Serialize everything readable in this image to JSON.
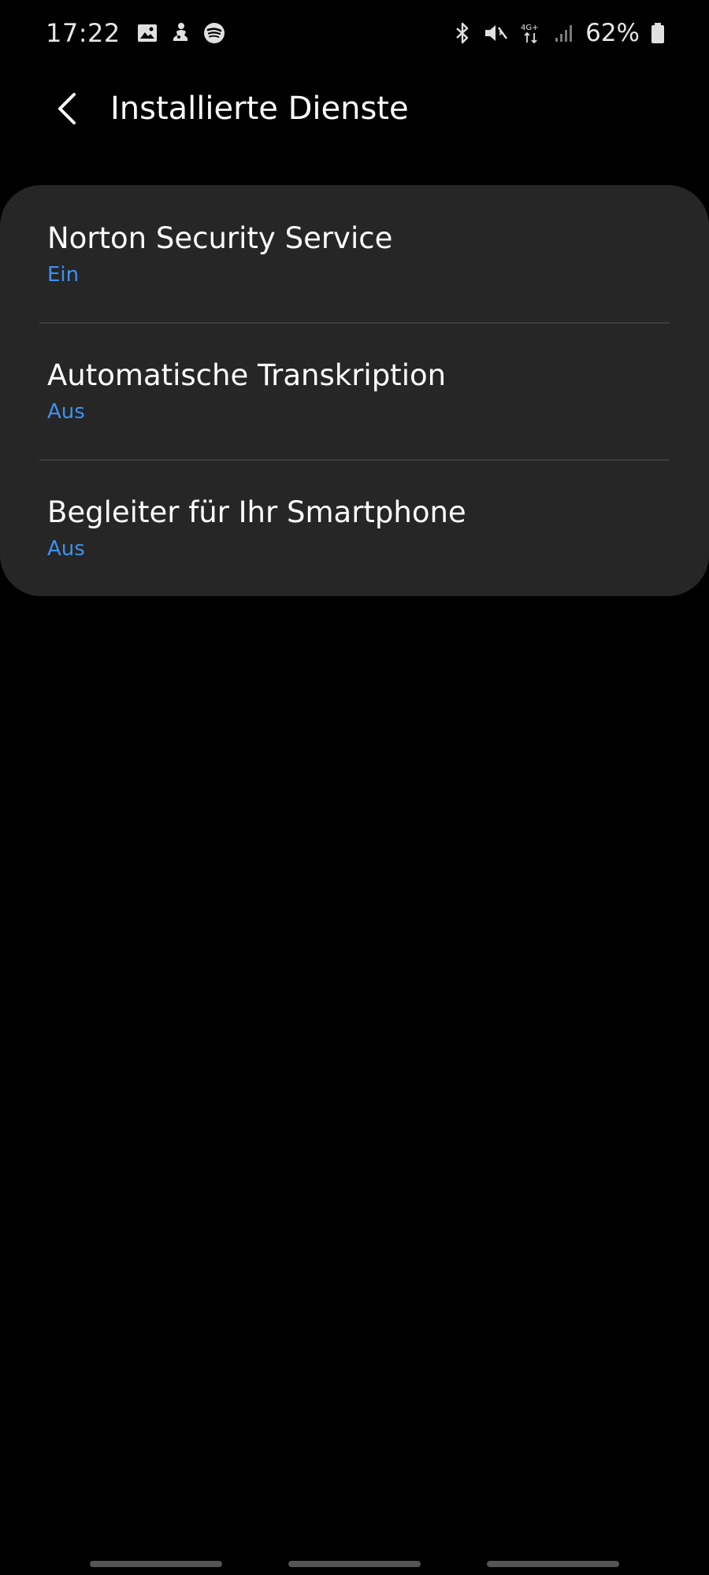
{
  "status_bar": {
    "time": "17:22",
    "left_icons": [
      "gallery-icon",
      "assistant-icon",
      "spotify-icon"
    ],
    "right_icons": [
      "bluetooth-icon",
      "vibrate-mute-icon",
      "network-4g-icon",
      "signal-icon",
      "battery-icon"
    ],
    "network_label": "4G+",
    "battery_percent": "62%"
  },
  "header": {
    "title": "Installierte Dienste"
  },
  "services": [
    {
      "title": "Norton Security Service",
      "status": "Ein"
    },
    {
      "title": "Automatische Transkription",
      "status": "Aus"
    },
    {
      "title": "Begleiter für Ihr Smartphone",
      "status": "Aus"
    }
  ],
  "colors": {
    "background": "#000000",
    "card": "#262626",
    "accent": "#3e91ef",
    "text_primary": "#ffffff",
    "divider": "#3d3d3d"
  }
}
